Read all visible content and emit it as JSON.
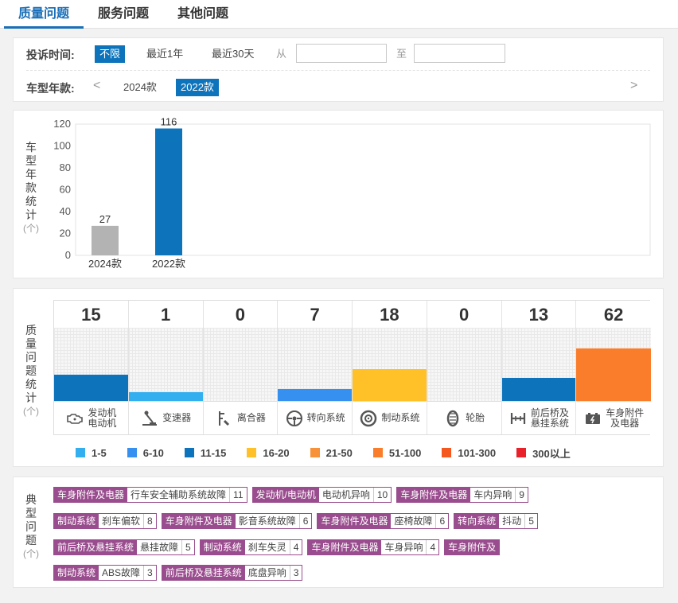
{
  "tabs": [
    {
      "label": "质量问题",
      "active": true
    },
    {
      "label": "服务问题",
      "active": false
    },
    {
      "label": "其他问题",
      "active": false
    }
  ],
  "filters": {
    "time_label": "投诉时间:",
    "time_options": [
      {
        "label": "不限",
        "selected": true
      },
      {
        "label": "最近1年",
        "selected": false
      },
      {
        "label": "最近30天",
        "selected": false
      }
    ],
    "from_label": "从",
    "to_label": "至",
    "from_value": "",
    "to_value": "",
    "year_label": "车型年款:",
    "prev_arrow": "<",
    "next_arrow": ">",
    "year_options": [
      {
        "label": "2024款",
        "selected": false
      },
      {
        "label": "2022款",
        "selected": true
      }
    ]
  },
  "year_chart": {
    "vertical_label": [
      "车",
      "型",
      "年",
      "款",
      "统",
      "计"
    ],
    "unit": "(个)"
  },
  "chart_data": {
    "type": "bar",
    "categories": [
      "2024款",
      "2022款"
    ],
    "values": [
      27,
      116
    ],
    "ylim": [
      0,
      120
    ],
    "yticks": [
      0,
      20,
      40,
      60,
      80,
      100,
      120
    ],
    "colors": [
      "#b3b3b3",
      "#0d74bc"
    ],
    "grid": false
  },
  "quality": {
    "vertical_label": [
      "质",
      "量",
      "问",
      "题",
      "统",
      "计"
    ],
    "unit": "(个)",
    "categories": [
      {
        "name": [
          "发动机",
          "电动机"
        ],
        "count": 15,
        "color": "#0d74bc",
        "icon": "engine-icon"
      },
      {
        "name": [
          "变速器"
        ],
        "count": 1,
        "color": "#33aff0",
        "icon": "gear-shift-icon"
      },
      {
        "name": [
          "离合器"
        ],
        "count": 0,
        "color": "#33aff0",
        "icon": "clutch-icon"
      },
      {
        "name": [
          "转向系统"
        ],
        "count": 7,
        "color": "#3590ef",
        "icon": "steering-wheel-icon"
      },
      {
        "name": [
          "制动系统"
        ],
        "count": 18,
        "color": "#ffc127",
        "icon": "brake-disc-icon"
      },
      {
        "name": [
          "轮胎"
        ],
        "count": 0,
        "color": "#33aff0",
        "icon": "tire-icon"
      },
      {
        "name": [
          "前后桥及",
          "悬挂系统"
        ],
        "count": 13,
        "color": "#0d74bc",
        "icon": "axle-icon"
      },
      {
        "name": [
          "车身附件",
          "及电器"
        ],
        "count": 62,
        "color": "#fa7d2b",
        "icon": "battery-icon"
      }
    ],
    "legend": [
      {
        "label": "1-5",
        "color": "#33aff0"
      },
      {
        "label": "6-10",
        "color": "#3590ef"
      },
      {
        "label": "11-15",
        "color": "#0d74bc"
      },
      {
        "label": "16-20",
        "color": "#ffc127"
      },
      {
        "label": "21-50",
        "color": "#f79238"
      },
      {
        "label": "51-100",
        "color": "#fa7d2b"
      },
      {
        "label": "101-300",
        "color": "#f4581f"
      },
      {
        "label": "300以上",
        "color": "#e8212a"
      }
    ]
  },
  "typical": {
    "vertical_label": [
      "典",
      "型",
      "问",
      "题"
    ],
    "unit": "(个)",
    "rows": [
      [
        {
          "cat": "车身附件及电器",
          "sub": "行车安全辅助系统故障",
          "count": "11"
        },
        {
          "cat": "发动机/电动机",
          "sub": "电动机异响",
          "count": "10"
        },
        {
          "cat": "车身附件及电器",
          "sub": "车内异响",
          "count": "9"
        }
      ],
      [
        {
          "cat": "制动系统",
          "sub": "刹车偏软",
          "count": "8"
        },
        {
          "cat": "车身附件及电器",
          "sub": "影音系统故障",
          "count": "6"
        },
        {
          "cat": "车身附件及电器",
          "sub": "座椅故障",
          "count": "6"
        },
        {
          "cat": "转向系统",
          "sub": "抖动",
          "count": "5"
        }
      ],
      [
        {
          "cat": "前后桥及悬挂系统",
          "sub": "悬挂故障",
          "count": "5"
        },
        {
          "cat": "制动系统",
          "sub": "刹车失灵",
          "count": "4"
        },
        {
          "cat": "车身附件及电器",
          "sub": "车身异响",
          "count": "4"
        },
        {
          "cat": "车身附件及",
          "sub": "",
          "count": ""
        }
      ],
      [
        {
          "cat": "制动系统",
          "sub": "ABS故障",
          "count": "3"
        },
        {
          "cat": "前后桥及悬挂系统",
          "sub": "底盘异响",
          "count": "3"
        }
      ]
    ]
  }
}
